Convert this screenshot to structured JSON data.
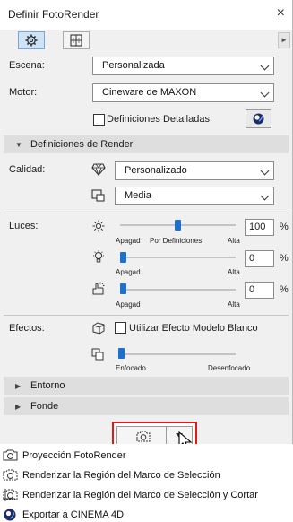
{
  "window": {
    "title": "Definir FotoRender",
    "close_glyph": "×"
  },
  "tabs": [
    {
      "icon": "gear-icon",
      "active": true
    },
    {
      "icon": "grid-icon",
      "active": false
    }
  ],
  "escena": {
    "label": "Escena:",
    "value": "Personalizada"
  },
  "motor": {
    "label": "Motor:",
    "value": "Cineware de MAXON"
  },
  "detailed": {
    "label": "Definiciones Detalladas",
    "checked": false
  },
  "render_defs": {
    "title": "Definiciones de Render",
    "expanded": true
  },
  "calidad": {
    "label": "Calidad:",
    "preset": "Personalizado",
    "level": "Media"
  },
  "luces": {
    "label": "Luces:",
    "sliders": [
      {
        "icon": "sun-icon",
        "value": "100",
        "unit": "%",
        "level": 100,
        "caps": [
          "Apagad",
          "Por Definiciones",
          "Alta"
        ]
      },
      {
        "icon": "bulb-icon",
        "value": "0",
        "unit": "%",
        "level": 0,
        "caps": [
          "Apagad",
          "Alta"
        ]
      },
      {
        "icon": "hand-light-icon",
        "value": "0",
        "unit": "%",
        "level": 0,
        "caps": [
          "Apagad",
          "Alta"
        ]
      }
    ]
  },
  "efectos": {
    "label": "Efectos:",
    "white_model": {
      "label": "Utilizar Efecto Modelo Blanco",
      "checked": false
    },
    "focus_caps": [
      "Enfocado",
      "Desenfocado"
    ],
    "focus_level": 0
  },
  "sections": [
    {
      "title": "Entorno",
      "expanded": false
    },
    {
      "title": "Fonde",
      "expanded": false
    }
  ],
  "render_menu": [
    {
      "label": "Proyección FotoRender"
    },
    {
      "label": "Renderizar la Región del Marco de Selección"
    },
    {
      "label": "Renderizar la Región del Marco de Selección y Cortar"
    },
    {
      "label": "Exportar a CINEMA 4D"
    }
  ],
  "accent_color": "#1c71d0",
  "highlight_color": "#e01818"
}
